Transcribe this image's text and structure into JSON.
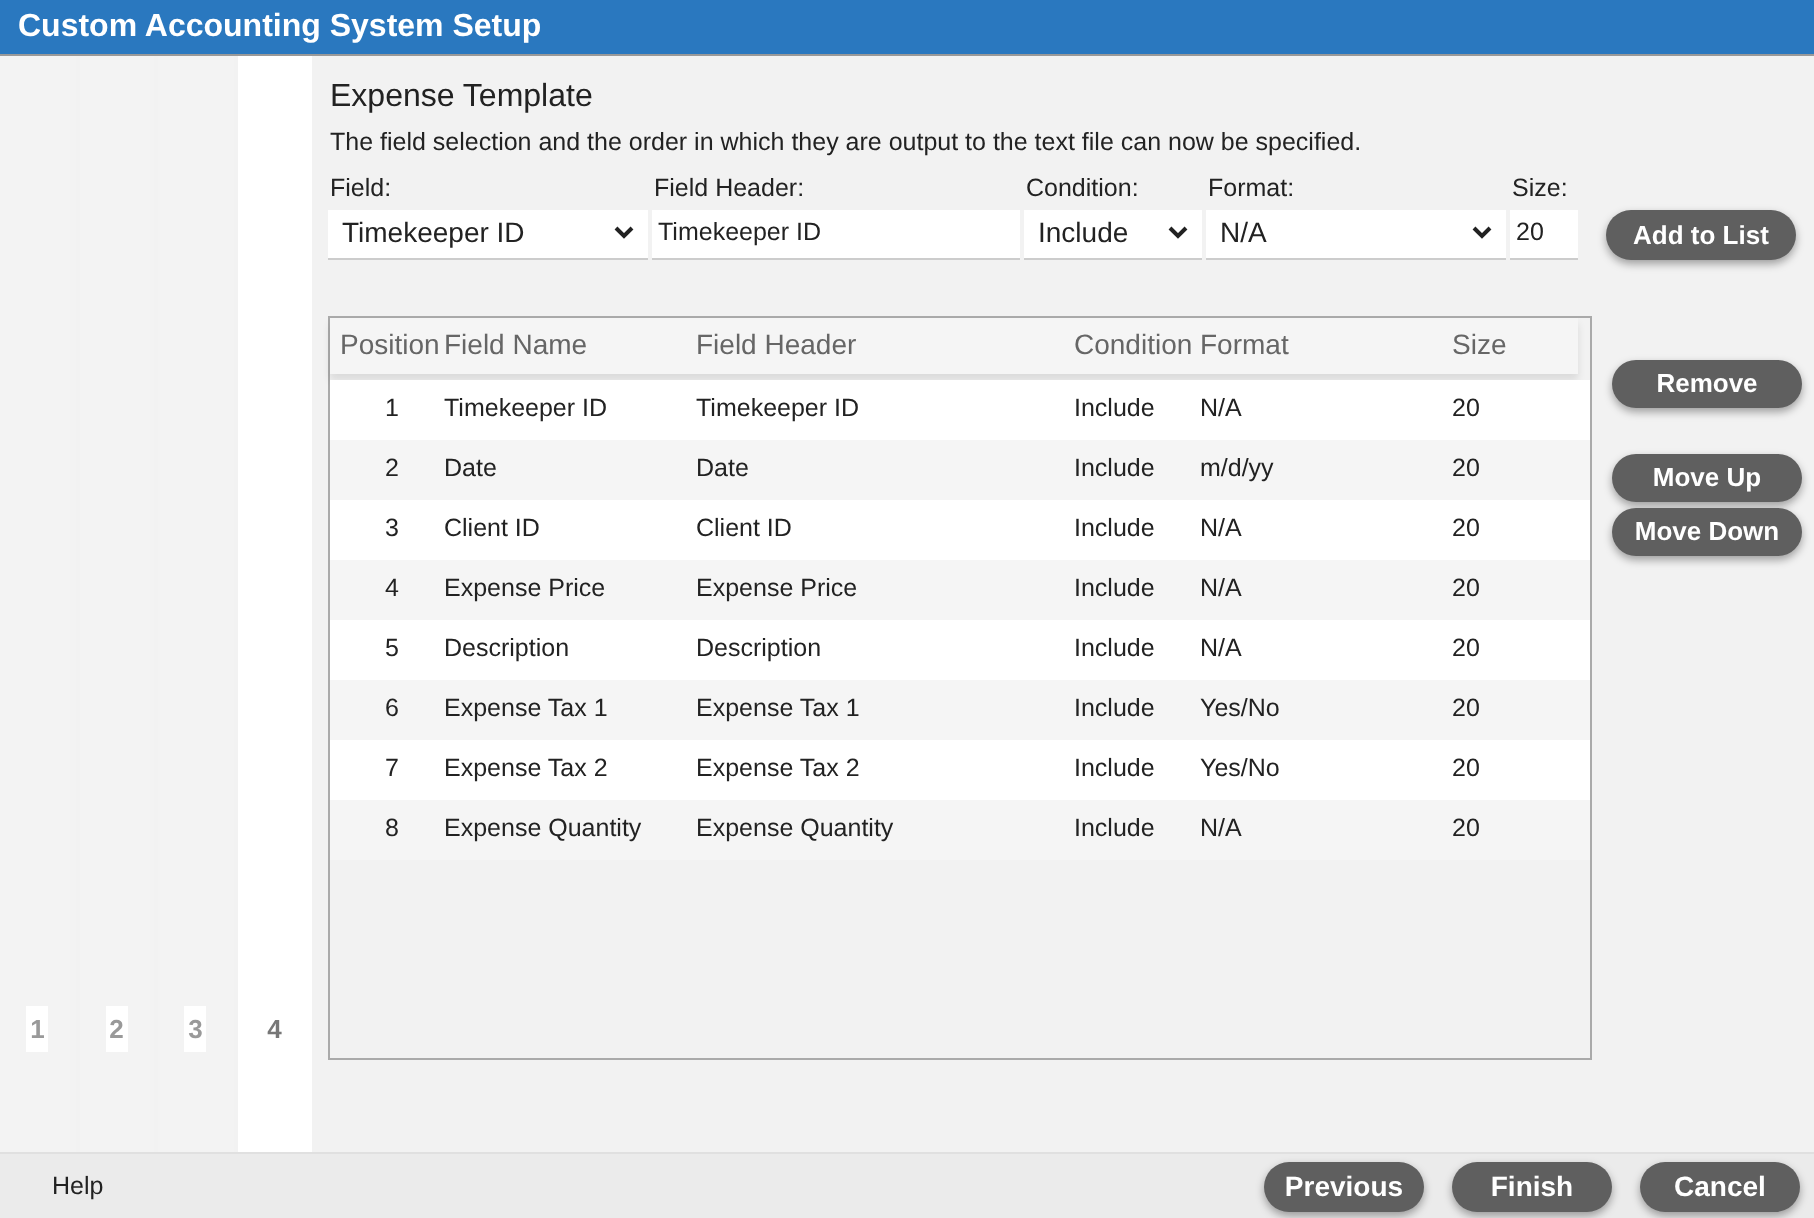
{
  "window": {
    "title": "Custom Accounting System Setup"
  },
  "steps": [
    {
      "label": "1",
      "selected": false
    },
    {
      "label": "2",
      "selected": false
    },
    {
      "label": "3",
      "selected": false
    },
    {
      "label": "4",
      "selected": true
    }
  ],
  "heading": "Expense Template",
  "description": "The field selection and the order in which they are output to the text file can now be specified.",
  "form": {
    "field": {
      "label": "Field:",
      "value": "Timekeeper ID"
    },
    "field_header": {
      "label": "Field Header:",
      "value": "Timekeeper ID"
    },
    "condition": {
      "label": "Condition:",
      "value": "Include"
    },
    "format": {
      "label": "Format:",
      "value": "N/A"
    },
    "size": {
      "label": "Size:",
      "value": "20"
    }
  },
  "add_button": "Add to List",
  "table": {
    "columns": [
      "Position",
      "Field Name",
      "Field Header",
      "Condition",
      "Format",
      "Size"
    ],
    "rows": [
      [
        "1",
        "Timekeeper ID",
        "Timekeeper ID",
        "Include",
        "N/A",
        "20"
      ],
      [
        "2",
        "Date",
        "Date",
        "Include",
        "m/d/yy",
        "20"
      ],
      [
        "3",
        "Client ID",
        "Client ID",
        "Include",
        "N/A",
        "20"
      ],
      [
        "4",
        "Expense Price",
        "Expense Price",
        "Include",
        "N/A",
        "20"
      ],
      [
        "5",
        "Description",
        "Description",
        "Include",
        "N/A",
        "20"
      ],
      [
        "6",
        "Expense Tax 1",
        "Expense Tax 1",
        "Include",
        "Yes/No",
        "20"
      ],
      [
        "7",
        "Expense Tax 2",
        "Expense Tax 2",
        "Include",
        "Yes/No",
        "20"
      ],
      [
        "8",
        "Expense Quantity",
        "Expense Quantity",
        "Include",
        "N/A",
        "20"
      ]
    ]
  },
  "side_buttons": [
    "Remove",
    "Move Up",
    "Move Down"
  ],
  "footer": {
    "help": "Help",
    "buttons": [
      "Previous",
      "Finish",
      "Cancel"
    ]
  }
}
